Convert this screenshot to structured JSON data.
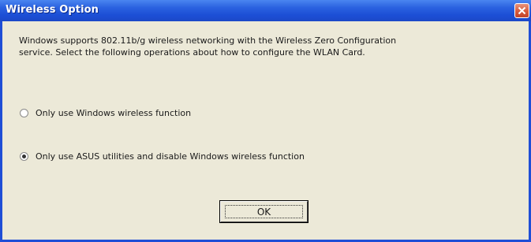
{
  "window": {
    "title": "Wireless Option"
  },
  "dialog": {
    "description": "Windows supports 802.11b/g wireless networking with the Wireless Zero Configuration\nservice. Select the following operations about how to configure the WLAN Card.",
    "options": [
      {
        "label": "Only use Windows wireless function",
        "selected": false
      },
      {
        "label": "Only use ASUS utilities and disable Windows wireless function",
        "selected": true
      }
    ],
    "ok_label": "OK"
  },
  "icons": {
    "close": "close-icon"
  },
  "colors": {
    "titlebar": "#1f4ed6",
    "client_background": "#ece9d8",
    "close_button": "#d85a3a"
  }
}
